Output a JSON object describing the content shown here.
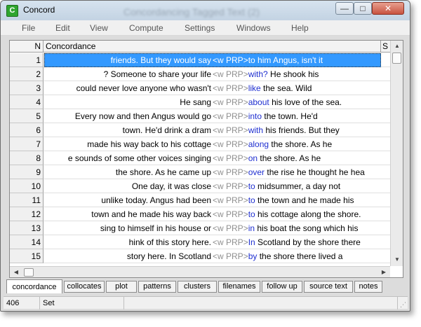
{
  "window": {
    "title": "Concord",
    "app_icon": "C",
    "background_title": "Concordancing Tagged Text (2)",
    "controls": {
      "minimize": "—",
      "maximize": "□",
      "close": "✕"
    }
  },
  "menu": [
    "File",
    "Edit",
    "View",
    "Compute",
    "Settings",
    "Windows",
    "Help"
  ],
  "grid": {
    "headers": {
      "n": "N",
      "concordance": "Concordance",
      "s": "S"
    },
    "tag_text": "<w PRP>",
    "selected_row": 1,
    "rows": [
      {
        "n": "1",
        "left": "friends. But they would say",
        "kw": "to",
        "right": " him Angus, isn't it"
      },
      {
        "n": "2",
        "left": "? Someone to share your life",
        "kw": "with?",
        "right": " He shook his"
      },
      {
        "n": "3",
        "left": "could never love anyone who wasn't",
        "kw": "like",
        "right": " the sea. Wild"
      },
      {
        "n": "4",
        "left": "He sang",
        "kw": "about",
        "right": " his love of the sea."
      },
      {
        "n": "5",
        "left": "Every now and then Angus would go",
        "kw": "into",
        "right": " the town. He'd"
      },
      {
        "n": "6",
        "left": "town. He'd drink a dram",
        "kw": "with",
        "right": " his friends. But they"
      },
      {
        "n": "7",
        "left": "made his way back to his cottage",
        "kw": "along",
        "right": " the shore. As he"
      },
      {
        "n": "8",
        "left": "e sounds of some other voices singing",
        "kw": "on",
        "right": " the shore. As he"
      },
      {
        "n": "9",
        "left": "the shore. As he came up",
        "kw": "over",
        "right": " the rise he thought he hea"
      },
      {
        "n": "10",
        "left": "One day, it was close",
        "kw": "to",
        "right": " midsummer, a day not"
      },
      {
        "n": "11",
        "left": "unlike today. Angus had been",
        "kw": "to",
        "right": " the town and he made his"
      },
      {
        "n": "12",
        "left": "town and he made his way back",
        "kw": "to",
        "right": " his cottage along the shore."
      },
      {
        "n": "13",
        "left": "sing to himself in his house or",
        "kw": "in",
        "right": " his boat the song which his"
      },
      {
        "n": "14",
        "left": "hink of this story here.",
        "kw": "In",
        "right": " Scotland by the shore there"
      },
      {
        "n": "15",
        "left": "story here. In Scotland",
        "kw": "by",
        "right": " the shore there lived a"
      }
    ]
  },
  "tabs": [
    "concordance",
    "collocates",
    "plot",
    "patterns",
    "clusters",
    "filenames",
    "follow up",
    "source text",
    "notes"
  ],
  "active_tab": "concordance",
  "status": {
    "count": "406",
    "state": "Set"
  },
  "colors": {
    "selection": "#3399ff",
    "keyword": "#1f2fd0",
    "tag": "#8f8f8f"
  }
}
